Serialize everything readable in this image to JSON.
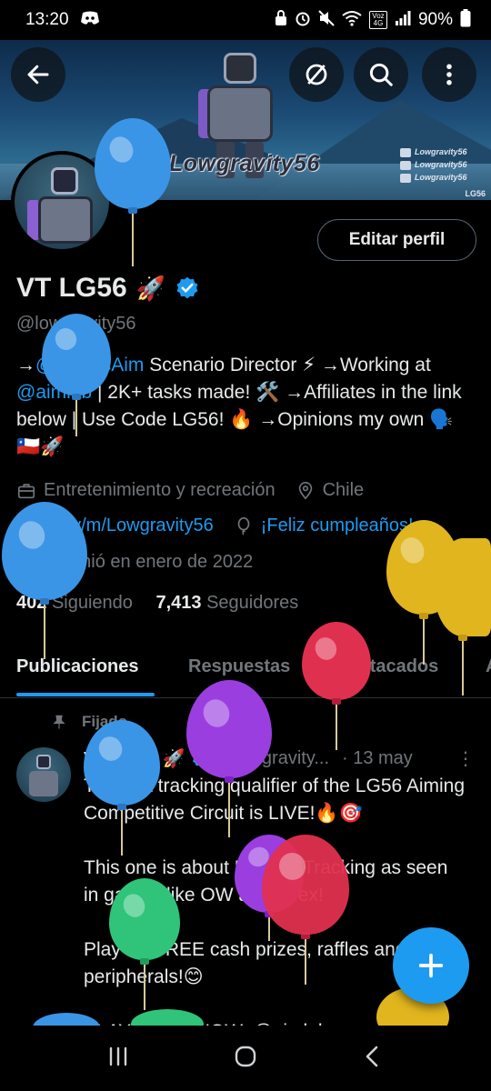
{
  "status_bar": {
    "time": "13:20",
    "battery": "90%",
    "network": "Voz 4G"
  },
  "banner": {
    "brand": "Lowgravity56",
    "socials": [
      "Lowgravity56",
      "Lowgravity56",
      "Lowgravity56"
    ],
    "tag": "LG56"
  },
  "profile": {
    "edit_label": "Editar perfil",
    "name": "VT LG56",
    "name_emoji": "🚀",
    "handle": "@lowgravity56",
    "bio_parts": {
      "p1": "→",
      "mention1": "@VoltaicAim",
      "p2": " Scenario Director ⚡ →Working at ",
      "mention2": "@aimlab",
      "p3": " | 2K+ tasks made! 🛠️ →Affiliates in the link below | Use Code LG56! 🔥 →Opinions my own 🗣️ 🇨🇱🚀"
    },
    "category": "Entretenimiento y recreación",
    "location": "Chile",
    "website": "bit.ly/m/Lowgravity56",
    "birthday": "¡Feliz cumpleaños!",
    "joined": "Se unió en enero de 2022",
    "following_count": "402",
    "following_label": "Siguiendo",
    "followers_count": "7,413",
    "followers_label": "Seguidores"
  },
  "tabs": [
    {
      "label": "Publicaciones",
      "active": true
    },
    {
      "label": "Respuestas",
      "active": false
    },
    {
      "label": "Destacados",
      "active": false
    },
    {
      "label": "A",
      "active": false
    }
  ],
  "post": {
    "pinned_label": "Fijado",
    "author": "VT LG56 🚀",
    "handle": "@lowgravity...",
    "date": "· 13 may",
    "more": "⋮",
    "text": "The first tracking qualifier of the LG56 Aiming Competitive Circuit is LIVE!🔥🎯\n\nThis one is about Precise Tracking as seen in games like OW and Apex!\n\nPlay for FREE cash prizes, raffles and peripherals!😊\n\nPLAY YOUR NOW: @aimlab"
  },
  "colors": {
    "accent": "#1d9bf0",
    "background": "#000000",
    "text_primary": "#e7e9ea",
    "text_secondary": "#71767b",
    "balloon_blue": "#3b95e6",
    "balloon_yellow": "#e0b51e",
    "balloon_red": "#e0304f",
    "balloon_purple": "#9a3ee0",
    "balloon_green": "#2fc47a"
  }
}
